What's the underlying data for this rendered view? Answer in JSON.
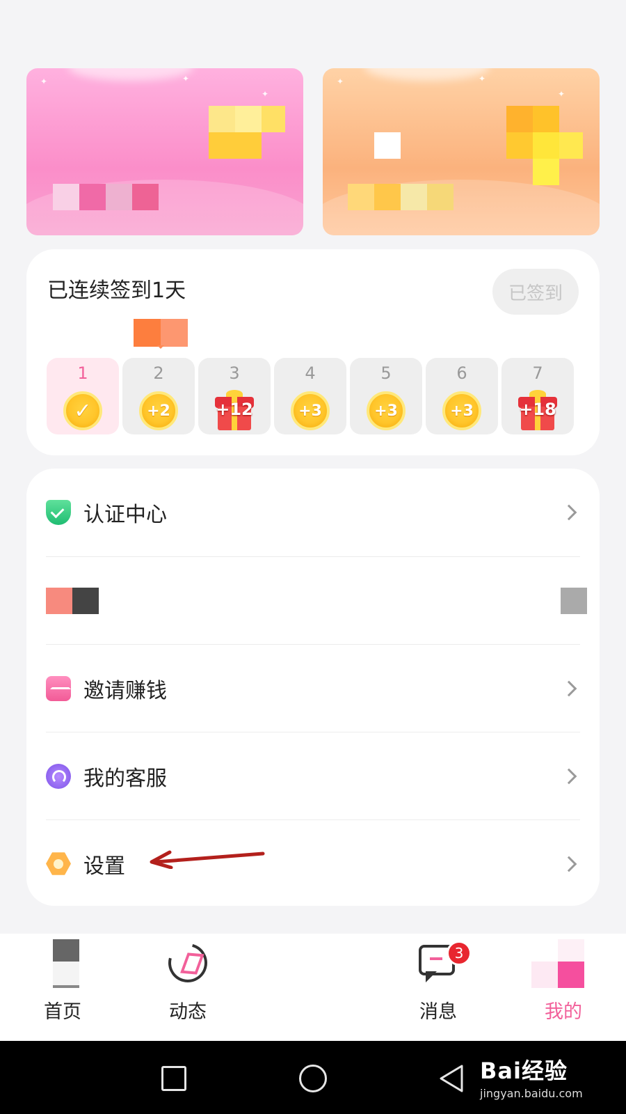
{
  "signin": {
    "title": "已连续签到1天",
    "button": "已签到",
    "days": [
      {
        "num": "1",
        "reward": "✓",
        "type": "check",
        "done": true
      },
      {
        "num": "2",
        "reward": "+2",
        "type": "coin"
      },
      {
        "num": "3",
        "reward": "+12",
        "type": "gift"
      },
      {
        "num": "4",
        "reward": "+3",
        "type": "coin"
      },
      {
        "num": "5",
        "reward": "+3",
        "type": "coin"
      },
      {
        "num": "6",
        "reward": "+3",
        "type": "coin"
      },
      {
        "num": "7",
        "reward": "+18",
        "type": "gift"
      }
    ]
  },
  "menu": {
    "items": [
      {
        "label": "认证中心",
        "icon": "shield-check-icon"
      },
      {
        "label": "",
        "icon": "pixelated-icon"
      },
      {
        "label": "邀请赚钱",
        "icon": "envelope-icon"
      },
      {
        "label": "我的客服",
        "icon": "headset-icon"
      },
      {
        "label": "设置",
        "icon": "gear-hexagon-icon"
      }
    ]
  },
  "tabbar": {
    "home": "首页",
    "moments": "动态",
    "messages": "消息",
    "messages_badge": "3",
    "mine": "我的"
  },
  "watermark": {
    "brand": "Bai经验",
    "sub": "jingyan.baidu.com"
  },
  "colors": {
    "accent": "#f2609a",
    "badge": "#e8262f",
    "coin": "#ffc52a"
  }
}
